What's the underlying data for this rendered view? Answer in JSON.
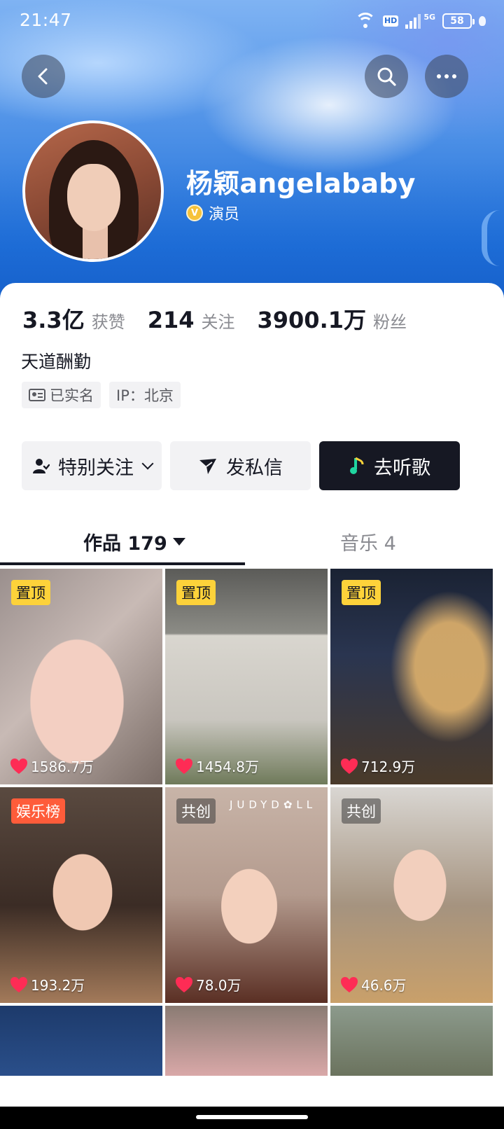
{
  "status_bar": {
    "time": "21:47",
    "net_label": "5G",
    "hd_label": "HD",
    "battery": "58"
  },
  "header": {
    "back_icon": "chevron-left-icon",
    "search_icon": "search-icon",
    "more_icon": "more-dots-icon"
  },
  "profile": {
    "name": "杨颖angelababy",
    "verified_label": "演员",
    "stats": [
      {
        "value": "3.3亿",
        "label": "获赞"
      },
      {
        "value": "214",
        "label": "关注"
      },
      {
        "value": "3900.1万",
        "label": "粉丝"
      }
    ],
    "bio": "天道酬勤",
    "tags": {
      "verified_id": "已实名",
      "ip": "IP：北京"
    }
  },
  "actions": {
    "follow": "特别关注",
    "message": "发私信",
    "music": "去听歌"
  },
  "tabs": {
    "works": "作品 179",
    "music": "音乐 4"
  },
  "grid": [
    {
      "badge": "置顶",
      "badge_type": "pinned",
      "likes": "1586.7万"
    },
    {
      "badge": "置顶",
      "badge_type": "pinned",
      "likes": "1454.8万"
    },
    {
      "badge": "置顶",
      "badge_type": "pinned",
      "likes": "712.9万"
    },
    {
      "badge": "娱乐榜",
      "badge_type": "rank",
      "likes": "193.2万"
    },
    {
      "badge": "共创",
      "badge_type": "collab",
      "likes": "78.0万",
      "watermark": "JUDYD✿LL"
    },
    {
      "badge": "共创",
      "badge_type": "collab",
      "likes": "46.6万"
    }
  ],
  "colors": {
    "accent_dark": "#161823",
    "pinned_badge": "#fdd23a",
    "rank_badge": "#fe5c3a",
    "heart": "#fe2c55",
    "music_note": "#20d5a0"
  }
}
